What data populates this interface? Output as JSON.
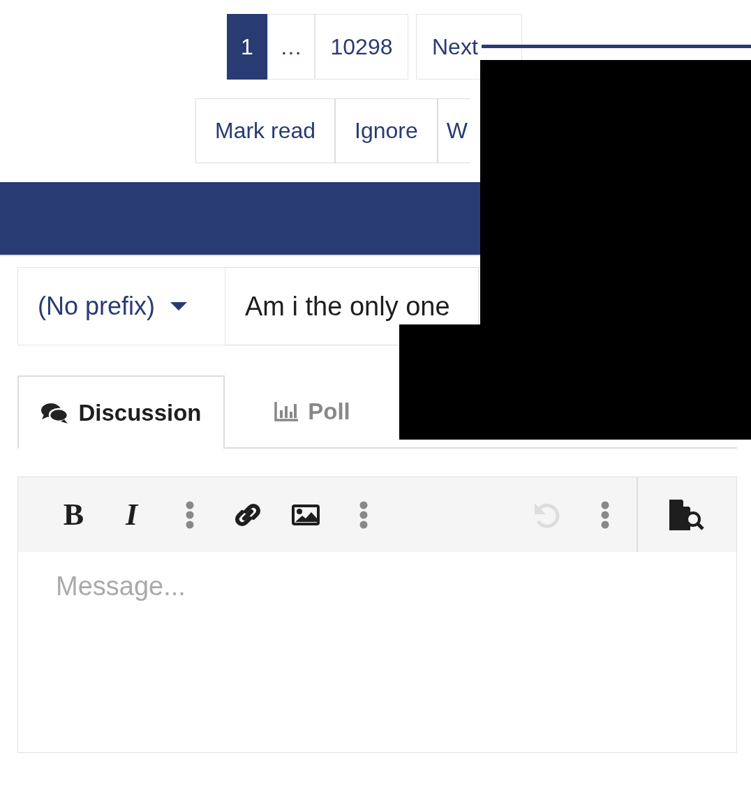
{
  "pagination": {
    "pages": [
      {
        "label": "1",
        "selected": true
      },
      {
        "label": "…",
        "selected": false
      },
      {
        "label": "10298",
        "selected": false
      }
    ],
    "next": "Next"
  },
  "thread_actions": [
    "Mark read",
    "Ignore",
    "W"
  ],
  "title_row": {
    "prefix": "(No prefix)",
    "title": "Am i the only one"
  },
  "tabs": [
    {
      "label": "Discussion",
      "kind": "discussion",
      "selected": true
    },
    {
      "label": "Poll",
      "kind": "poll",
      "selected": false
    }
  ],
  "toolbar": [
    {
      "kind": "bold",
      "label": "B",
      "disabled": false
    },
    {
      "kind": "italic",
      "label": "I",
      "disabled": false
    },
    {
      "kind": "more",
      "disabled": false
    },
    {
      "kind": "link",
      "disabled": false
    },
    {
      "kind": "image",
      "disabled": false
    },
    {
      "kind": "more",
      "disabled": false
    },
    {
      "kind": "undo",
      "disabled": true
    },
    {
      "kind": "more",
      "disabled": false
    },
    {
      "kind": "preview",
      "disabled": false
    }
  ],
  "message": {
    "placeholder": "Message..."
  }
}
